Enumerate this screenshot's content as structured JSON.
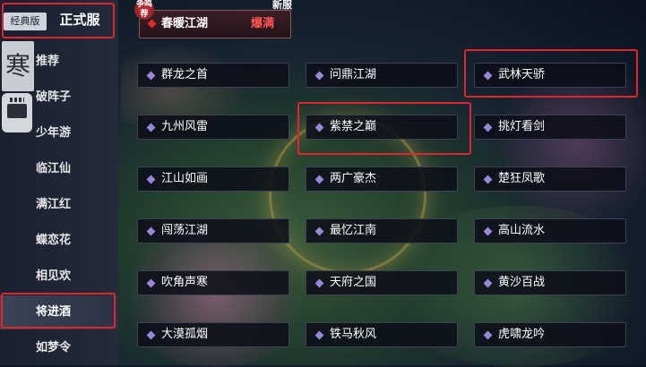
{
  "header": {
    "tab_classic": "经典版",
    "tab_official": "正式服"
  },
  "sidebar": {
    "logo_char": "寒",
    "items": [
      {
        "label": "推荐"
      },
      {
        "label": "破阵子"
      },
      {
        "label": "少年游"
      },
      {
        "label": "临江仙"
      },
      {
        "label": "满江红"
      },
      {
        "label": "蝶恋花"
      },
      {
        "label": "相见欢"
      },
      {
        "label": "将进酒"
      },
      {
        "label": "如梦令"
      }
    ],
    "active_item": "将进酒"
  },
  "featured": {
    "badge_recommend": "争鸣荐",
    "badge_new": "新服",
    "name": "春暖江湖",
    "status": "爆满"
  },
  "servers": [
    {
      "name": "群龙之首"
    },
    {
      "name": "问鼎江湖"
    },
    {
      "name": "武林天骄"
    },
    {
      "name": "九州风雷"
    },
    {
      "name": "紫禁之巅"
    },
    {
      "name": "挑灯看剑"
    },
    {
      "name": "江山如画"
    },
    {
      "name": "两广豪杰"
    },
    {
      "name": "楚狂凤歌"
    },
    {
      "name": "闯荡江湖"
    },
    {
      "name": "最忆江南"
    },
    {
      "name": "高山流水"
    },
    {
      "name": "吹角声寒"
    },
    {
      "name": "天府之国"
    },
    {
      "name": "黄沙百战"
    },
    {
      "name": "大漠孤烟"
    },
    {
      "name": "铁马秋风"
    },
    {
      "name": "虎啸龙吟"
    }
  ],
  "colors": {
    "highlight_frame": "#e0262a",
    "server_dot": "#9a86d8",
    "hot_text": "#ff5454"
  }
}
